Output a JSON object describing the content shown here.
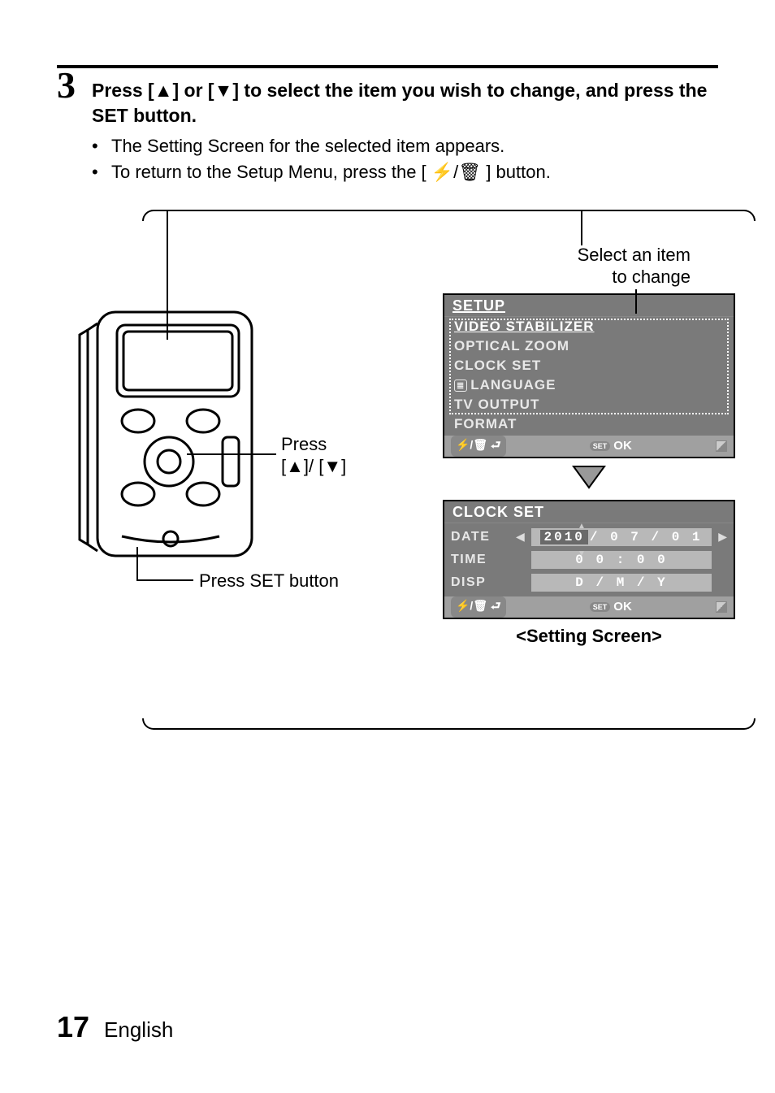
{
  "step": {
    "number": "3",
    "title_part1": "Press [",
    "title_glyph_up": "▲",
    "title_part2": "] or [",
    "title_glyph_down": "▼",
    "title_part3": "] to select the item you wish to change, and press the SET button.",
    "bullets": [
      "The Setting Screen for the selected item appears.",
      "To return to the Setup Menu, press the [ ⚡/🗑 ] button."
    ]
  },
  "callouts": {
    "press_arrows_line1": "Press",
    "press_arrows_line2": "[▲]/ [▼]",
    "press_set": "Press SET button",
    "select_item_line1": "Select an item",
    "select_item_line2": "to change"
  },
  "setup_menu": {
    "title": "SETUP",
    "items": [
      {
        "label": "VIDEO STABILIZER",
        "active": true
      },
      {
        "label": "OPTICAL ZOOM",
        "active": false
      },
      {
        "label": "CLOCK SET",
        "active": false
      },
      {
        "label": "LANGUAGE",
        "active": false,
        "icon": "≣"
      },
      {
        "label": "TV OUTPUT",
        "active": false
      },
      {
        "label": "FORMAT",
        "active": false
      }
    ],
    "footer": {
      "back_glyph": "⚡/🗑 ⮐",
      "set": "SET",
      "ok": "OK"
    }
  },
  "clock_screen": {
    "title": "CLOCK SET",
    "rows": {
      "date": {
        "label": "DATE",
        "year": "2010",
        "rest": "/ 0 7 / 0 1"
      },
      "time": {
        "label": "TIME",
        "value": "0 0 : 0 0"
      },
      "disp": {
        "label": "DISP",
        "value": "D / M / Y"
      }
    },
    "footer": {
      "back_glyph": "⚡/🗑 ⮐",
      "set": "SET",
      "ok": "OK"
    }
  },
  "setting_caption": "<Setting Screen>",
  "footer": {
    "page": "17",
    "lang": "English"
  }
}
